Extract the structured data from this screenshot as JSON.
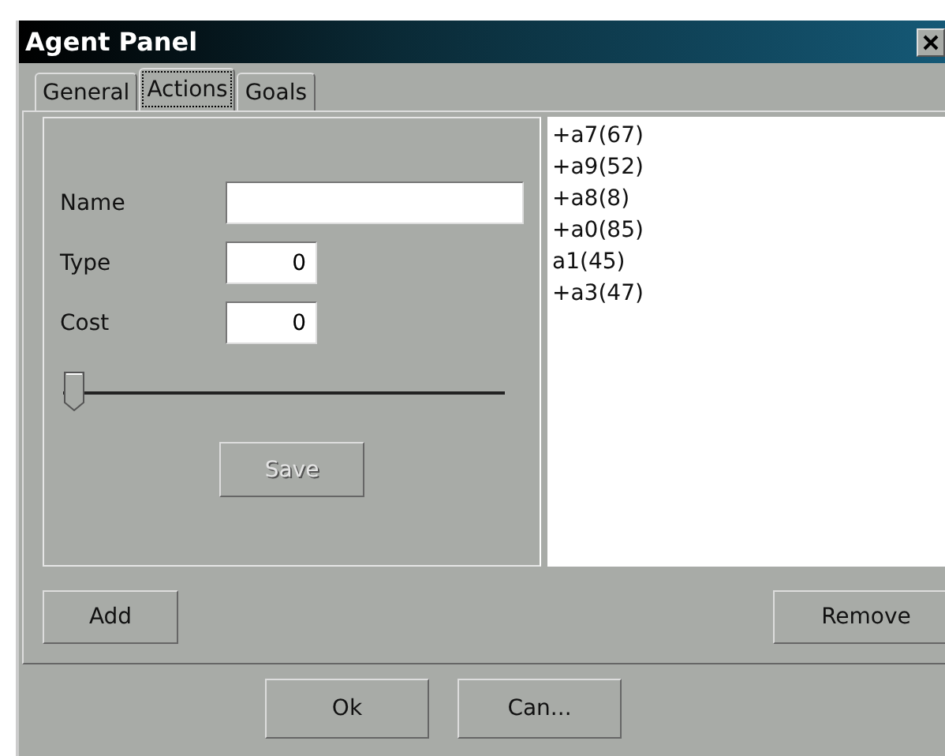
{
  "window": {
    "title": "Agent Panel"
  },
  "tabs": [
    {
      "label": "General",
      "selected": false
    },
    {
      "label": "Actions",
      "selected": true
    },
    {
      "label": "Goals",
      "selected": false
    }
  ],
  "form": {
    "fields": [
      {
        "label": "Name"
      },
      {
        "label": "Type",
        "value": "0"
      },
      {
        "label": "Cost",
        "value": "0"
      }
    ],
    "slider": {
      "level": 0
    },
    "save_button": {
      "label": "Save",
      "disabled": true
    }
  },
  "actions": [
    "+a7(67)",
    "+a9(52)",
    "+a8(8)",
    "+a0(85)",
    "a1(45)",
    "+a3(47)"
  ],
  "add_button": "Add",
  "remove_button": "Remove",
  "buttons": [
    "Ok",
    "Can..."
  ]
}
